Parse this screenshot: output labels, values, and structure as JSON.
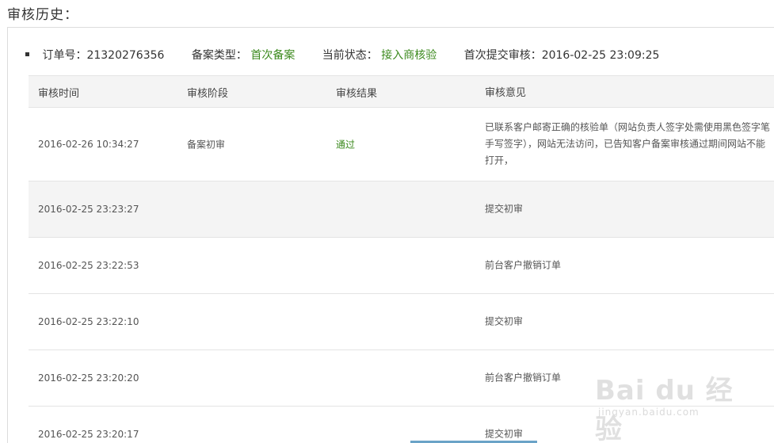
{
  "page": {
    "title": "审核历史："
  },
  "order": {
    "order_label": "订单号：",
    "order_number": "21320276356",
    "type_label": "备案类型：",
    "type_value": "首次备案",
    "status_label": "当前状态：",
    "status_value": "接入商核验",
    "submit_label": "首次提交审核：",
    "submit_time": "2016-02-25 23:09:25"
  },
  "table": {
    "headers": [
      "审核时间",
      "审核阶段",
      "审核结果",
      "审核意见"
    ],
    "rows": [
      {
        "time": "2016-02-26 10:34:27",
        "stage": "备案初审",
        "result": "通过",
        "opinion": "已联系客户邮寄正确的核验单（网站负责人签字处需使用黑色签字笔手写签字），网站无法访问，已告知客户备案审核通过期间网站不能打开，"
      },
      {
        "time": "2016-02-25 23:23:27",
        "stage": "",
        "result": "",
        "opinion": "提交初审"
      },
      {
        "time": "2016-02-25 23:22:53",
        "stage": "",
        "result": "",
        "opinion": "前台客户撤销订单"
      },
      {
        "time": "2016-02-25 23:22:10",
        "stage": "",
        "result": "",
        "opinion": "提交初审"
      },
      {
        "time": "2016-02-25 23:20:20",
        "stage": "",
        "result": "",
        "opinion": "前台客户撤销订单"
      },
      {
        "time": "2016-02-25 23:20:17",
        "stage": "",
        "result": "",
        "opinion": "提交初审"
      }
    ]
  },
  "watermark": {
    "brand": "Bai du 经验",
    "site": "jingyan.baidu.com"
  },
  "colors": {
    "accent_green": "#3c8a1e",
    "row_alt": "#f4f4f4",
    "border": "#dcdcdc"
  }
}
